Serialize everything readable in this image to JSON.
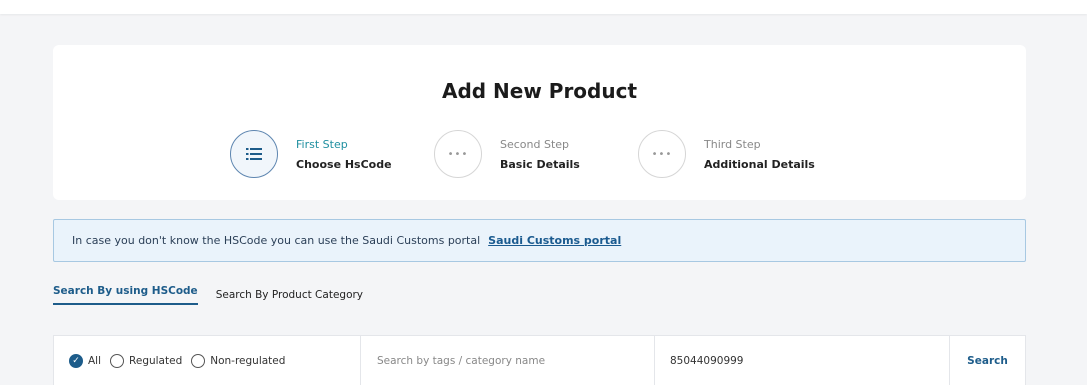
{
  "page": {
    "title": "Add New Product"
  },
  "steps": [
    {
      "label": "First Step",
      "name": "Choose HsCode",
      "icon": "list-icon",
      "active": true
    },
    {
      "label": "Second Step",
      "name": "Basic Details",
      "icon": "ellipsis-icon",
      "active": false
    },
    {
      "label": "Third Step",
      "name": "Additional Details",
      "icon": "ellipsis-icon",
      "active": false
    }
  ],
  "info": {
    "text": "In case you don't know the HSCode you can use the Saudi Customs portal",
    "link": "Saudi Customs portal"
  },
  "tabs": [
    {
      "label": "Search By using HSCode",
      "active": true
    },
    {
      "label": "Search By Product Category",
      "active": false
    }
  ],
  "filters": {
    "options": [
      {
        "label": "All",
        "checked": true
      },
      {
        "label": "Regulated",
        "checked": false
      },
      {
        "label": "Non-regulated",
        "checked": false
      }
    ],
    "tags_placeholder": "Search by tags / category name",
    "hscode_value": "85044090999",
    "search_label": "Search"
  },
  "colors": {
    "accent": "#1d5c8a",
    "step_active": "#1f8fa0",
    "info_bg": "#eaf3fb",
    "info_border": "#a7c8e2"
  }
}
